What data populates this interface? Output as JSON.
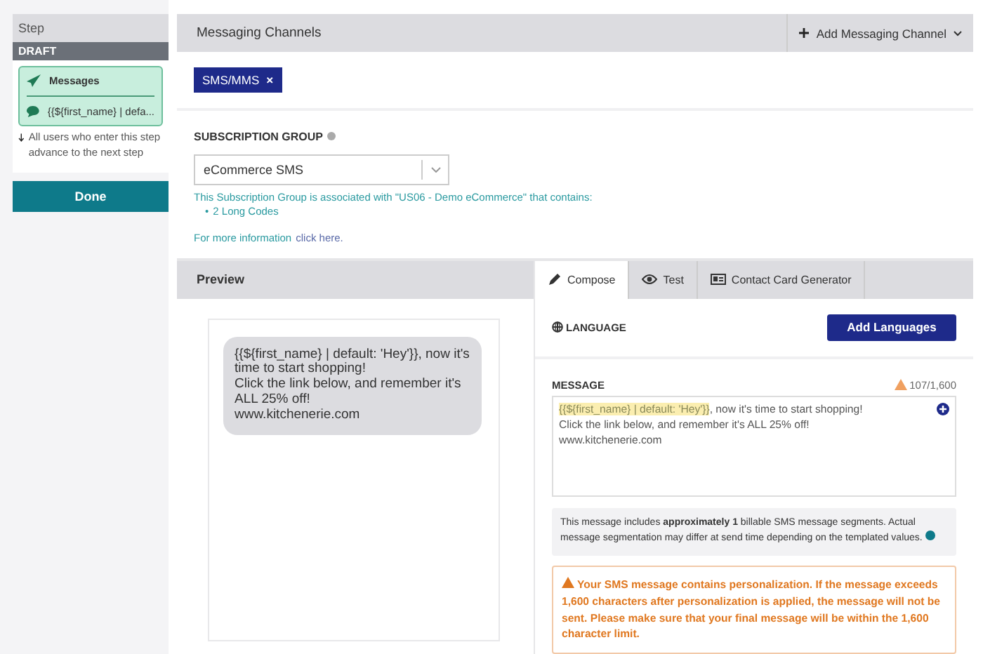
{
  "sidebar": {
    "title": "Step",
    "status": "DRAFT",
    "step": {
      "title": "Messages",
      "preview": "{{${first_name} | defa..."
    },
    "note": "All users who enter this step advance to the next step",
    "done_button": "Done"
  },
  "channels": {
    "title": "Messaging Channels",
    "add_button": "Add Messaging Channel",
    "tags": [
      {
        "label": "SMS/MMS",
        "close": "×"
      }
    ]
  },
  "subscription": {
    "label": "SUBSCRIPTION GROUP",
    "value": "eCommerce SMS",
    "info": "This Subscription Group is associated with \"US06 - Demo eCommerce\" that contains:",
    "items": [
      {
        "bullet": "•",
        "text": "2 Long Codes"
      }
    ],
    "more_text": "For more information",
    "more_link": "click here."
  },
  "preview": {
    "title": "Preview",
    "bubble": "{{${first_name} | default: 'Hey'}}, now it's time to start shopping!\nClick the link below, and remember it's ALL 25% off!\nwww.kitchenerie.com"
  },
  "tabs": [
    {
      "label": "Compose",
      "kind": "pencil",
      "selected": true
    },
    {
      "label": "Test",
      "kind": "eye",
      "selected": false
    },
    {
      "label": "Contact Card Generator",
      "kind": "card",
      "selected": false
    }
  ],
  "language": {
    "label": "LANGUAGE",
    "button": "Add Languages"
  },
  "message": {
    "label": "MESSAGE",
    "count": "107/1,600",
    "segments": [
      {
        "kind": "liquid",
        "text": "{{${first_name} | default: 'Hey'}}"
      },
      {
        "kind": "plain",
        "text": ", now it's time to start shopping!\nClick the link below, and remember it's ALL 25% off!\nwww.kitchenerie.com"
      }
    ]
  },
  "segment_info": "This message includes **approximately 1** billable SMS message segments. Actual message segmentation may differ at send time depending on the templated values.",
  "warning": "Your SMS message contains personalization. If the message exceeds 1,600 characters after personalization is applied, the message will not be sent. Please make sure that your final message will be within the 1,600 character limit."
}
